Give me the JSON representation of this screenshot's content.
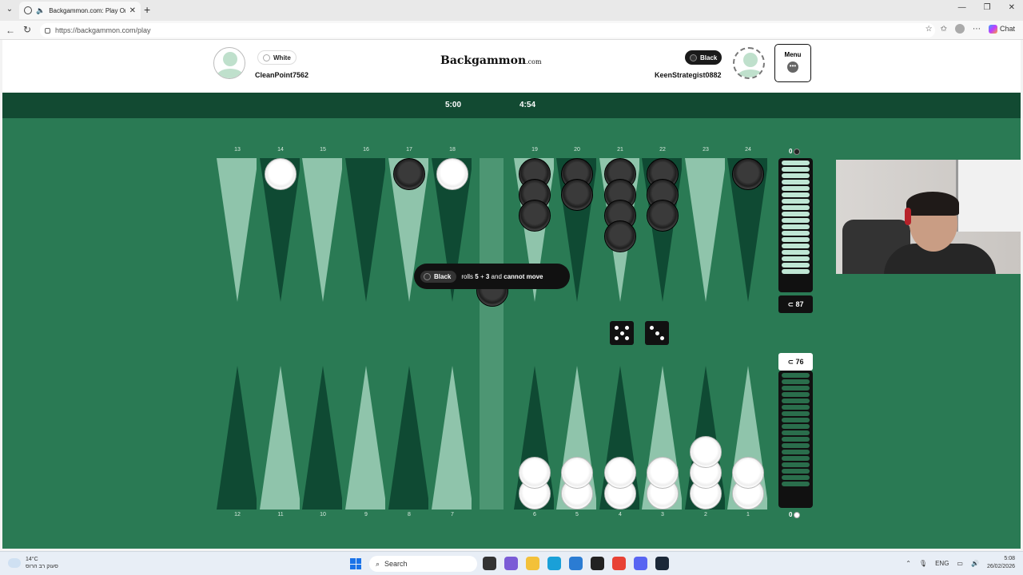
{
  "browser": {
    "tab_title": "Backgammon.com: Play Onlin",
    "url": "https://backgammon.com/play",
    "chat_label": "Chat"
  },
  "header": {
    "logo_main": "Backgammon",
    "logo_suffix": ".com",
    "menu_label": "Menu",
    "players": {
      "white": {
        "color_label": "White",
        "username": "CleanPoint7562"
      },
      "black": {
        "color_label": "Black",
        "username": "KeenStrategist0882"
      }
    }
  },
  "clocks": {
    "white": "5:00",
    "black": "4:54"
  },
  "board": {
    "top_points": [
      "13",
      "14",
      "15",
      "16",
      "17",
      "18",
      "19",
      "20",
      "21",
      "22",
      "23",
      "24"
    ],
    "bottom_points": [
      "12",
      "11",
      "10",
      "9",
      "8",
      "7",
      "6",
      "5",
      "4",
      "3",
      "2",
      "1"
    ],
    "checkers": {
      "top": {
        "14": {
          "color": "white",
          "count": 1
        },
        "17": {
          "color": "black",
          "count": 1
        },
        "18": {
          "color": "white",
          "count": 1
        },
        "19": {
          "color": "black",
          "count": 3
        },
        "20": {
          "color": "black",
          "count": 2
        },
        "21": {
          "color": "black",
          "count": 4
        },
        "22": {
          "color": "black",
          "count": 3
        },
        "24": {
          "color": "black",
          "count": 1
        }
      },
      "bottom": {
        "6": {
          "color": "white",
          "count": 2
        },
        "5": {
          "color": "white",
          "count": 2
        },
        "4": {
          "color": "white",
          "count": 2
        },
        "3": {
          "color": "white",
          "count": 2
        },
        "2": {
          "color": "white",
          "count": 3
        },
        "1": {
          "color": "white",
          "count": 2
        }
      }
    },
    "black_borne_off": "0",
    "white_borne_off": "0",
    "black_pip": "87",
    "white_pip": "76",
    "pip_prefix": "⊂",
    "colors": {
      "felt": "#2a7a54",
      "dark_point": "#0f4a33",
      "light_point": "#8fc4ab",
      "bar": "#4d9673",
      "topbar": "#124a32"
    }
  },
  "toast": {
    "player": "Black",
    "text_pre": "rolls",
    "die1": "5",
    "plus": "+",
    "die2": "3",
    "and": "and",
    "result": "cannot move"
  },
  "dice": [
    5,
    3
  ],
  "taskbar": {
    "temperature": "14°C",
    "weather_text": "סעוק רב הרוס",
    "search_placeholder": "Search",
    "lang": "ENG",
    "time": "5:08",
    "date": "26/02/2026"
  }
}
